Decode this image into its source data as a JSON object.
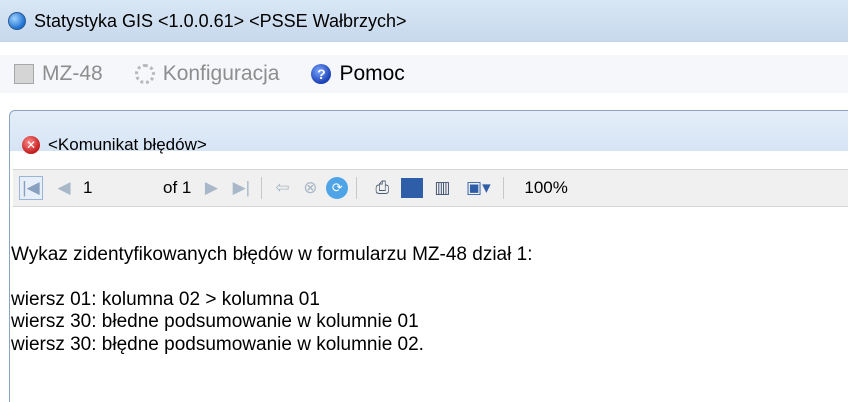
{
  "window": {
    "title": "Statystyka GIS <1.0.0.61> <PSSE Wałbrzych>"
  },
  "menu": {
    "items": [
      {
        "label": "MZ-48",
        "icon": "document-icon",
        "enabled": false
      },
      {
        "label": "Konfiguracja",
        "icon": "gear-icon",
        "enabled": false
      },
      {
        "label": "Pomoc",
        "icon": "help-icon",
        "enabled": true
      }
    ]
  },
  "report": {
    "header_title": "<Komunikat błędów>",
    "toolbar": {
      "page_number": "1",
      "page_total": "of 1",
      "zoom": "100%"
    },
    "content": {
      "heading": "Wykaz zidentyfikowanych błędów w formularzu MZ-48 dział 1:",
      "lines": [
        "wiersz 01: kolumna 02 > kolumna 01",
        "wiersz 30: błedne podsumowanie w kolumnie 01",
        "wiersz 30: błędne podsumowanie w kolumnie 02."
      ]
    }
  }
}
